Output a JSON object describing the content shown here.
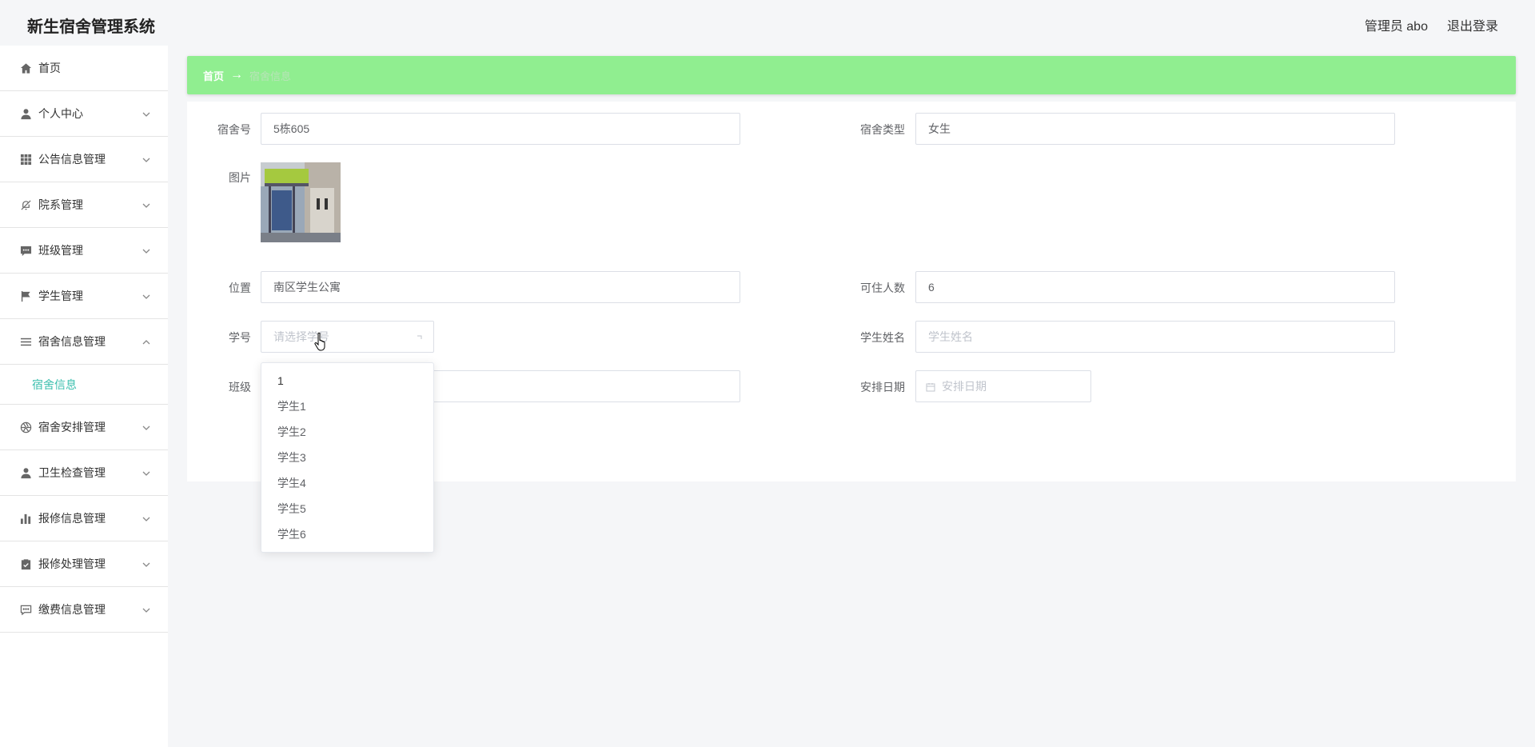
{
  "header": {
    "title": "新生宿舍管理系统",
    "user_label": "管理员 abo",
    "logout_label": "退出登录"
  },
  "sidebar": {
    "items": [
      {
        "label": "首页",
        "icon": "home-icon"
      },
      {
        "label": "个人中心",
        "icon": "user-icon"
      },
      {
        "label": "公告信息管理",
        "icon": "grid-icon"
      },
      {
        "label": "院系管理",
        "icon": "bell-off-icon"
      },
      {
        "label": "班级管理",
        "icon": "chat-icon"
      },
      {
        "label": "学生管理",
        "icon": "flag-icon"
      },
      {
        "label": "宿舍信息管理",
        "icon": "list-icon"
      },
      {
        "label": "宿舍安排管理",
        "icon": "aperture-icon"
      },
      {
        "label": "卫生检查管理",
        "icon": "user-icon"
      },
      {
        "label": "报修信息管理",
        "icon": "bar-chart-icon"
      },
      {
        "label": "报修处理管理",
        "icon": "clipboard-icon"
      },
      {
        "label": "缴费信息管理",
        "icon": "message-icon"
      }
    ],
    "submenu_label": "宿舍信息"
  },
  "breadcrumb": {
    "home": "首页",
    "separator": "→",
    "current": "宿舍信息"
  },
  "form": {
    "dorm_no_label": "宿舍号",
    "dorm_no_value": "5栋605",
    "dorm_type_label": "宿舍类型",
    "dorm_type_value": "女生",
    "image_label": "图片",
    "location_label": "位置",
    "location_value": "南区学生公寓",
    "capacity_label": "可住人数",
    "capacity_value": "6",
    "student_no_label": "学号",
    "student_no_placeholder": "请选择学号",
    "student_name_label": "学生姓名",
    "student_name_placeholder": "学生姓名",
    "class_label": "班级",
    "date_label": "安排日期",
    "date_placeholder": "安排日期"
  },
  "dropdown": {
    "options": [
      "1",
      "学生1",
      "学生2",
      "学生3",
      "学生4",
      "学生5",
      "学生6"
    ]
  },
  "colors": {
    "breadcrumb_bg": "#90ee90",
    "submenu_active": "#3bbfae"
  }
}
